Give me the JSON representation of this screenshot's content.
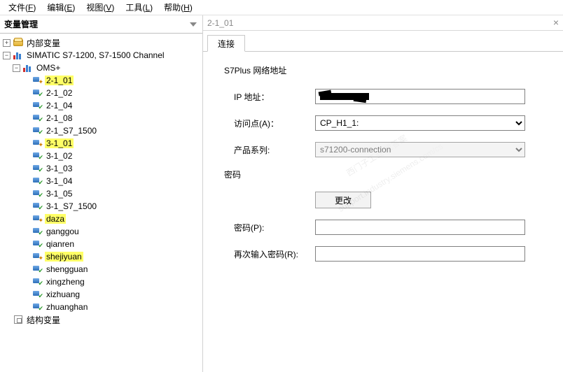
{
  "menu": {
    "file": "文件",
    "edit": "编辑",
    "view": "视图",
    "tools": "工具",
    "help": "帮助",
    "file_u": "F",
    "edit_u": "E",
    "view_u": "V",
    "tools_u": "L",
    "help_u": "H"
  },
  "left": {
    "title": "变量管理",
    "root_internal": "内部变量",
    "channel": "SIMATIC S7-1200, S7-1500 Channel",
    "oms": "OMS+",
    "items": [
      {
        "label": "2-1_01",
        "hl": true
      },
      {
        "label": "2-1_02"
      },
      {
        "label": "2-1_04"
      },
      {
        "label": "2-1_08"
      },
      {
        "label": "2-1_S7_1500"
      },
      {
        "label": "3-1_01",
        "hl": true
      },
      {
        "label": "3-1_02"
      },
      {
        "label": "3-1_03"
      },
      {
        "label": "3-1_04"
      },
      {
        "label": "3-1_05"
      },
      {
        "label": "3-1_S7_1500"
      },
      {
        "label": "daza",
        "hl": true
      },
      {
        "label": "ganggou"
      },
      {
        "label": "qianren"
      },
      {
        "label": "shejiyuan",
        "hl": true
      },
      {
        "label": "shengguan"
      },
      {
        "label": "xingzheng"
      },
      {
        "label": "xizhuang"
      },
      {
        "label": "zhuanghan"
      }
    ],
    "struct": "结构变量"
  },
  "right": {
    "title": "2-1_01",
    "tab": "连接",
    "section": "S7Plus 网络地址",
    "ip_label": "IP 地址：",
    "access_label": "访问点(A)：",
    "access_value": "CP_H1_1:",
    "product_label": "产品系列:",
    "product_value": "s71200-connection",
    "pwd_section": "密码",
    "change_btn": "更改",
    "pwd_label": "密码(P):",
    "pwd2_label": "再次输入密码(R):"
  },
  "watermark": {
    "l1": "西门子工业 找答案",
    "l2": "support.industry.siemens.com/cs"
  }
}
